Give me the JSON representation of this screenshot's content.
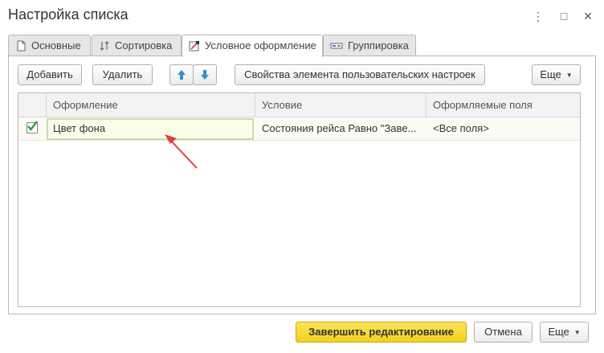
{
  "window": {
    "title": "Настройка списка",
    "more_icon": "⋮",
    "maximize_icon": "□",
    "close_icon": "✕"
  },
  "tabs": [
    {
      "label": "Основные",
      "icon": "page-icon"
    },
    {
      "label": "Сортировка",
      "icon": "sort-icon"
    },
    {
      "label": "Условное оформление",
      "icon": "conditional-format-icon"
    },
    {
      "label": "Группировка",
      "icon": "grouping-icon"
    }
  ],
  "toolbar": {
    "add_label": "Добавить",
    "delete_label": "Удалить",
    "up_icon": "arrow-up-icon",
    "down_icon": "arrow-down-icon",
    "properties_label": "Свойства элемента пользовательских настроек",
    "more_label": "Еще"
  },
  "table": {
    "columns": [
      "Оформление",
      "Условие",
      "Оформляемые поля"
    ],
    "rows": [
      {
        "checked": true,
        "appearance": "Цвет фона",
        "condition": "Состояния рейса Равно \"Заве...",
        "fields": "<Все поля>"
      }
    ]
  },
  "footer": {
    "finish_label": "Завершить редактирование",
    "cancel_label": "Отмена",
    "more_label": "Еще"
  },
  "colors": {
    "primary_button": "#f5d72f",
    "arrow_annotation": "#e0403a",
    "checkmark": "#2e9e3e",
    "arrow_buttons": "#3a8ad8"
  }
}
